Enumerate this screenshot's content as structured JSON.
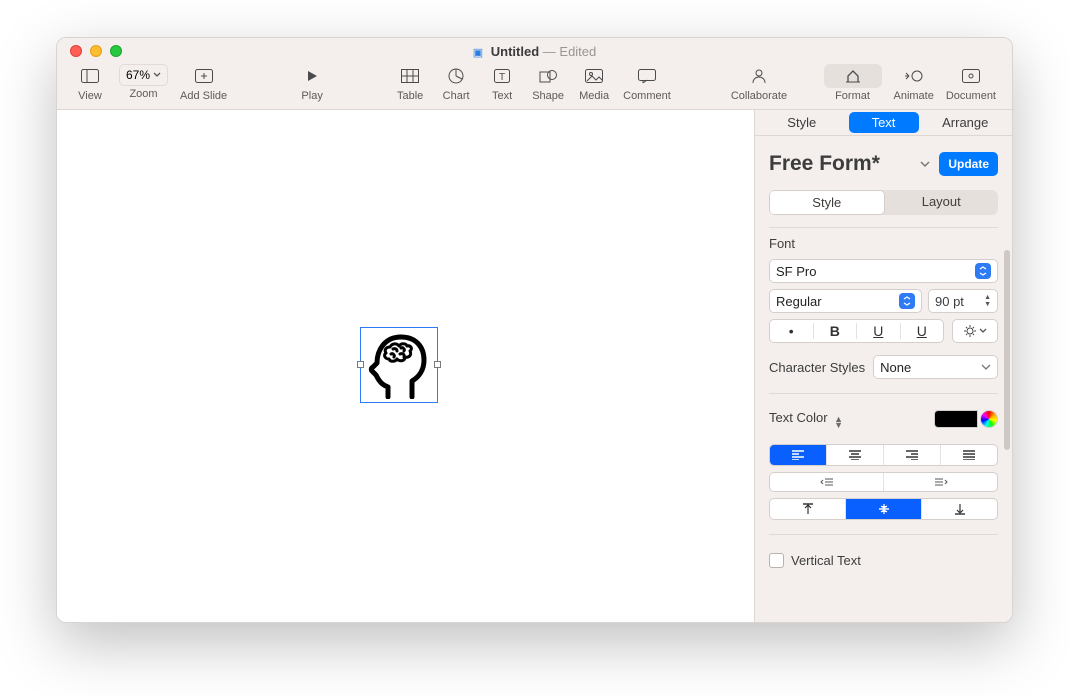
{
  "window": {
    "title": "Untitled",
    "edited_suffix": "— Edited"
  },
  "toolbar": {
    "view": "View",
    "zoom_value": "67%",
    "zoom": "Zoom",
    "add_slide": "Add Slide",
    "play": "Play",
    "table": "Table",
    "chart": "Chart",
    "text": "Text",
    "shape": "Shape",
    "media": "Media",
    "comment": "Comment",
    "collaborate": "Collaborate",
    "format": "Format",
    "animate": "Animate",
    "document": "Document"
  },
  "inspector": {
    "tabs": {
      "style": "Style",
      "text": "Text",
      "arrange": "Arrange"
    },
    "paragraph_style": "Free Form*",
    "update": "Update",
    "subtabs": {
      "style": "Style",
      "layout": "Layout"
    },
    "font_label": "Font",
    "font_family": "SF Pro",
    "font_weight": "Regular",
    "font_size": "90 pt",
    "character_styles_label": "Character Styles",
    "character_style": "None",
    "text_color_label": "Text Color",
    "text_color": "#000000",
    "vertical_text_label": "Vertical Text",
    "vertical_text_checked": false
  }
}
